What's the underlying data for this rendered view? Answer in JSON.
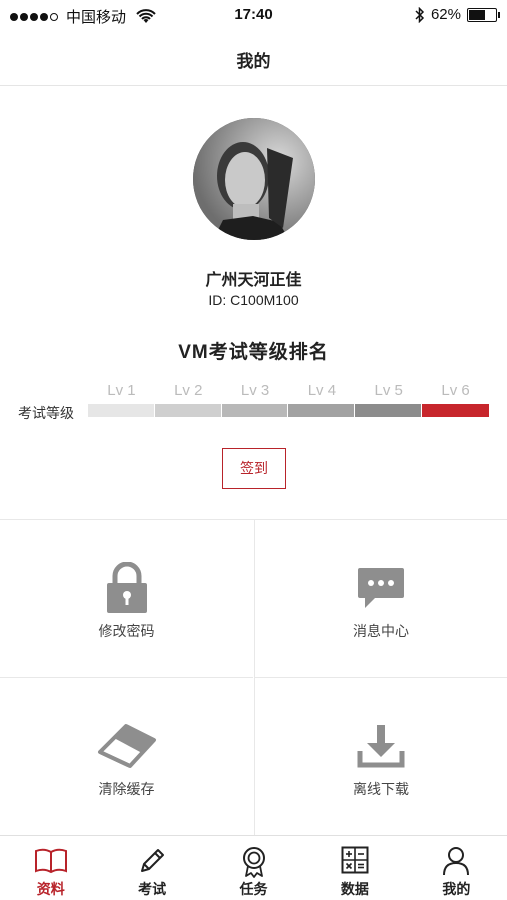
{
  "status_bar": {
    "carrier": "中国移动",
    "time": "17:40",
    "battery_percent": "62%",
    "battery_level": 0.62
  },
  "nav": {
    "title": "我的"
  },
  "profile": {
    "name": "广州天河正佳",
    "id_text": "ID: C100M100"
  },
  "ranking": {
    "title": "VM考试等级排名",
    "row_label": "考试等级",
    "current_level": "Lv 6",
    "levels": [
      {
        "label": "Lv 1",
        "color": "#e6e6e6"
      },
      {
        "label": "Lv 2",
        "color": "#cfcfcf"
      },
      {
        "label": "Lv 3",
        "color": "#b8b8b8"
      },
      {
        "label": "Lv 4",
        "color": "#a2a2a2"
      },
      {
        "label": "Lv 5",
        "color": "#8c8c8c"
      },
      {
        "label": "Lv 6",
        "color": "#c7262c"
      }
    ]
  },
  "signin": {
    "label": "签到"
  },
  "grid": [
    {
      "label": "修改密码",
      "icon": "lock-icon"
    },
    {
      "label": "消息中心",
      "icon": "message-icon"
    },
    {
      "label": "清除缓存",
      "icon": "eraser-icon"
    },
    {
      "label": "离线下载",
      "icon": "download-icon"
    }
  ],
  "tabs": [
    {
      "label": "资料",
      "icon": "book-icon",
      "active": true
    },
    {
      "label": "考试",
      "icon": "pencil-icon",
      "active": false
    },
    {
      "label": "任务",
      "icon": "medal-icon",
      "active": false
    },
    {
      "label": "数据",
      "icon": "calculator-icon",
      "active": false
    },
    {
      "label": "我的",
      "icon": "user-icon",
      "active": false
    }
  ],
  "colors": {
    "accent": "#b8232a",
    "icon_gray": "#8e8e8e"
  }
}
